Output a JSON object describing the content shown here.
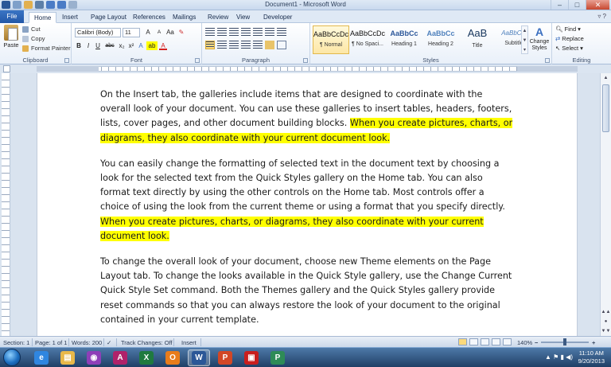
{
  "window": {
    "title": "Document1 - Microsoft Word",
    "minimize": "‒",
    "maximize": "□",
    "close": "✕"
  },
  "tabs": {
    "file": "File",
    "items": [
      "Home",
      "Insert",
      "Page Layout",
      "References",
      "Mailings",
      "Review",
      "View",
      "Developer"
    ],
    "help_icons": "▿ ?"
  },
  "clipboard": {
    "paste": "Paste",
    "cut": "Cut",
    "copy": "Copy",
    "format_painter": "Format Painter",
    "label": "Clipboard"
  },
  "font": {
    "name": "Calibri (Body)",
    "size": "11",
    "grow": "A",
    "shrink": "A",
    "clear": "Aa",
    "bold": "B",
    "italic": "I",
    "underline": "U",
    "strike": "abc",
    "sub": "x₂",
    "sup": "x²",
    "effects": "A",
    "highlight": "ab",
    "color": "A",
    "label": "Font"
  },
  "paragraph": {
    "label": "Paragraph"
  },
  "styles": {
    "label": "Styles",
    "items": [
      {
        "sample": "AaBbCcDc",
        "name": "¶ Normal",
        "color": "#111111"
      },
      {
        "sample": "AaBbCcDc",
        "name": "¶ No Spaci...",
        "color": "#111111"
      },
      {
        "sample": "AaBbCc",
        "name": "Heading 1",
        "color": "#2b579a"
      },
      {
        "sample": "AaBbCc",
        "name": "Heading 2",
        "color": "#4f81bd"
      },
      {
        "sample": "AaB",
        "name": "Title",
        "color": "#17365d"
      },
      {
        "sample": "AaBbCc.",
        "name": "Subtitle",
        "color": "#4f81bd"
      }
    ],
    "change_styles": "Change Styles"
  },
  "editing": {
    "find": "Find",
    "replace": "Replace",
    "select": "Select",
    "label": "Editing"
  },
  "document": {
    "paragraphs": [
      {
        "plain": "On the Insert tab, the galleries include items that are designed to coordinate with the overall look of your document. You can use these galleries to insert tables, headers, footers, lists, cover pages, and other document building blocks. ",
        "highlight": "When you create pictures, charts, or diagrams, they also coordinate with your current document look."
      },
      {
        "plain": "You can easily change the formatting of selected text in the document text by choosing a look for the selected text from the Quick Styles gallery on the Home tab. You can also format text directly by using the other controls on the Home tab. Most controls offer a choice of using the look from the current theme or using a format that you specify directly. ",
        "highlight": "When you create pictures, charts, or diagrams, they also coordinate with your current document look."
      },
      {
        "plain": "To change the overall look of your document, choose new Theme elements on the Page Layout tab. To change the looks available in the Quick Style gallery, use the Change Current Quick Style Set command. Both the Themes gallery and the Quick Styles gallery provide reset commands so that you can always restore the look of your document to the original contained in your current template.",
        "highlight": ""
      }
    ]
  },
  "status": {
    "section": "Section: 1",
    "page": "Page: 1 of 1",
    "words": "Words: 200",
    "track": "Track Changes: Off",
    "mode": "Insert",
    "zoom": "140%",
    "zoom_out": "−",
    "zoom_in": "+"
  },
  "taskbar": {
    "apps": [
      {
        "glyph": "e",
        "color": "#2f86e0",
        "name": "internet-explorer"
      },
      {
        "glyph": "▤",
        "color": "#e8b84a",
        "name": "file-explorer"
      },
      {
        "glyph": "◉",
        "color": "#8e3fb8",
        "name": "onenote-circle"
      },
      {
        "glyph": "A",
        "color": "#b0226a",
        "name": "access"
      },
      {
        "glyph": "X",
        "color": "#1f7a3f",
        "name": "excel"
      },
      {
        "glyph": "O",
        "color": "#e87c1b",
        "name": "outlook"
      },
      {
        "glyph": "W",
        "color": "#2b5797",
        "name": "word"
      },
      {
        "glyph": "P",
        "color": "#d24726",
        "name": "powerpoint"
      },
      {
        "glyph": "▣",
        "color": "#c81e1e",
        "name": "photoshop"
      },
      {
        "glyph": "P",
        "color": "#2e8b57",
        "name": "publisher"
      }
    ],
    "time": "11:10 AM",
    "date": "9/20/2013",
    "tray": "▲ ⚑ ▮ ◀)"
  }
}
